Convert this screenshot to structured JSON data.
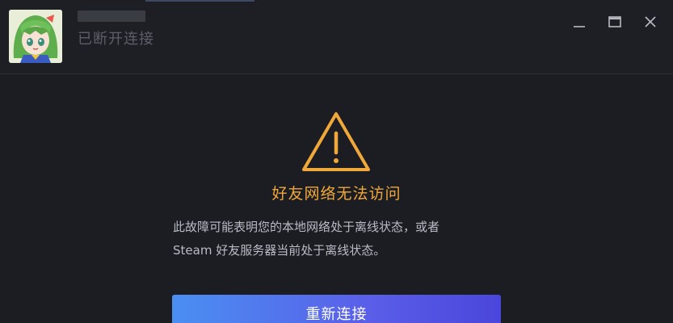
{
  "header": {
    "status": "已断开连接"
  },
  "controls": {
    "minimize_icon": "minimize-icon",
    "maximize_icon": "maximize-icon",
    "close_icon": "close-icon"
  },
  "error": {
    "icon": "warning-triangle-icon",
    "title": "好友网络无法访问",
    "line1": "此故障可能表明您的本地网络处于离线状态，或者",
    "line2": "Steam 好友服务器当前处于离线状态。",
    "button_label": "重新连接"
  },
  "colors": {
    "accent": "#f0a83a",
    "button_start": "#4a8ff2",
    "button_end": "#4a46db",
    "background": "#1c1d22"
  }
}
